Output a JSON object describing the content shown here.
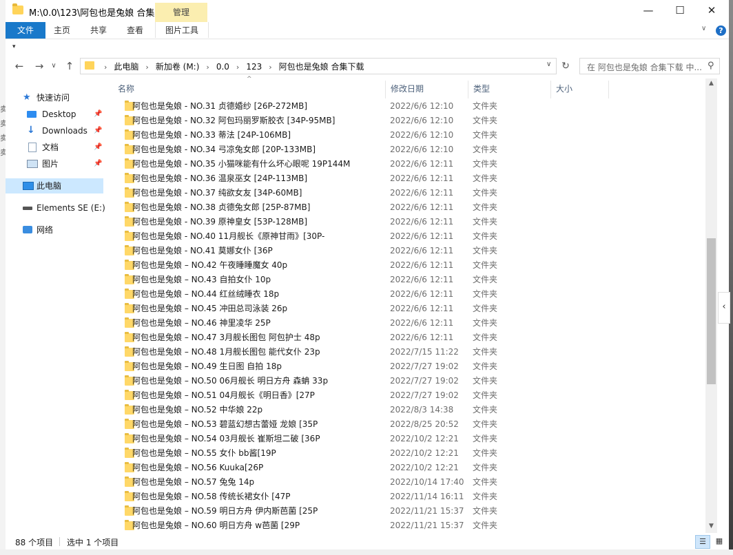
{
  "window": {
    "title": "M:\\0.0\\123\\阿包也是兔娘 合集...",
    "context_tab_header": "管理",
    "controls": {
      "minimize": "—",
      "maximize": "☐",
      "close": "✕"
    }
  },
  "ribbon": {
    "file_tab": "文件",
    "tabs": [
      "主页",
      "共享",
      "查看"
    ],
    "picture_tools_tab": "图片工具",
    "collapse": "∨",
    "help": "?"
  },
  "qat": {
    "arrow": "▾"
  },
  "nav": {
    "back": "←",
    "forward": "→",
    "recent": "∨",
    "up": "↑"
  },
  "address": {
    "crumbs": [
      "此电脑",
      "新加卷 (M:)",
      "0.0",
      "123",
      "阿包也是兔娘 合集下载"
    ],
    "separator": "›",
    "dropdown": "∨",
    "refresh": "↻"
  },
  "search": {
    "placeholder": "在 阿包也是兔娘 合集下载 中...",
    "icon": "⚲"
  },
  "outside_left_chars": [
    "卖",
    "卖",
    "卖",
    "卖"
  ],
  "navpane": {
    "quick_access": "快速访问",
    "items": [
      {
        "label": "Desktop",
        "icon": "desktop-icon"
      },
      {
        "label": "Downloads",
        "icon": "downloads-icon"
      },
      {
        "label": "文档",
        "icon": "documents-icon"
      },
      {
        "label": "图片",
        "icon": "pictures-icon"
      }
    ],
    "pin": "📌",
    "this_pc": "此电脑",
    "elements": "Elements SE (E:)",
    "network": "网络"
  },
  "columns": {
    "name": "名称",
    "date": "修改日期",
    "type": "类型",
    "size": "大小",
    "sort_arrow": "^"
  },
  "files": [
    {
      "name": "阿包也是兔娘 - NO.31 贞德婚纱 [26P-272MB]",
      "date": "2022/6/6 12:10",
      "type": "文件夹"
    },
    {
      "name": "阿包也是兔娘 - NO.32 阿包玛丽罗斯胶衣 [34P-95MB]",
      "date": "2022/6/6 12:10",
      "type": "文件夹"
    },
    {
      "name": "阿包也是兔娘 - NO.33 蒂法 [24P-106MB]",
      "date": "2022/6/6 12:10",
      "type": "文件夹"
    },
    {
      "name": "阿包也是兔娘 - NO.34 弓凉兔女郎 [20P-133MB]",
      "date": "2022/6/6 12:10",
      "type": "文件夹"
    },
    {
      "name": "阿包也是兔娘 - NO.35 小猫咪能有什么坏心眼呢 19P144M",
      "date": "2022/6/6 12:11",
      "type": "文件夹"
    },
    {
      "name": "阿包也是兔娘 - NO.36 温泉巫女 [24P-113MB]",
      "date": "2022/6/6 12:11",
      "type": "文件夹"
    },
    {
      "name": "阿包也是兔娘 - NO.37 纯欲女友 [34P-60MB]",
      "date": "2022/6/6 12:11",
      "type": "文件夹"
    },
    {
      "name": "阿包也是兔娘 - NO.38 贞德兔女郎 [25P-87MB]",
      "date": "2022/6/6 12:11",
      "type": "文件夹"
    },
    {
      "name": "阿包也是兔娘 - NO.39 原神皇女 [53P-128MB]",
      "date": "2022/6/6 12:11",
      "type": "文件夹"
    },
    {
      "name": "阿包也是兔娘 - NO.40 11月舰长《原神甘雨》[30P-",
      "date": "2022/6/6 12:11",
      "type": "文件夹"
    },
    {
      "name": "阿包也是兔娘 - NO.41 莫娜女仆 [36P",
      "date": "2022/6/6 12:11",
      "type": "文件夹"
    },
    {
      "name": "阿包也是兔娘 – NO.42 午夜睡睡魔女 40p",
      "date": "2022/6/6 12:11",
      "type": "文件夹"
    },
    {
      "name": "阿包也是兔娘 – NO.43 自拍女仆 10p",
      "date": "2022/6/6 12:11",
      "type": "文件夹"
    },
    {
      "name": "阿包也是兔娘 – NO.44 红丝绒睡衣 18p",
      "date": "2022/6/6 12:11",
      "type": "文件夹"
    },
    {
      "name": "阿包也是兔娘 – NO.45 冲田总司泳装 26p",
      "date": "2022/6/6 12:11",
      "type": "文件夹"
    },
    {
      "name": "阿包也是兔娘 – NO.46 神里凌华 25P",
      "date": "2022/6/6 12:11",
      "type": "文件夹"
    },
    {
      "name": "阿包也是兔娘 – NO.47 3月舰长图包 阿包护士 48p",
      "date": "2022/6/6 12:11",
      "type": "文件夹"
    },
    {
      "name": "阿包也是兔娘 – NO.48 1月舰长图包 能代女仆 23p",
      "date": "2022/7/15 11:22",
      "type": "文件夹"
    },
    {
      "name": "阿包也是兔娘 – NO.49 生日图 自拍 18p",
      "date": "2022/7/27 19:02",
      "type": "文件夹"
    },
    {
      "name": "阿包也是兔娘 – NO.50 06月舰长 明日方舟 森蚺 33p",
      "date": "2022/7/27 19:02",
      "type": "文件夹"
    },
    {
      "name": "阿包也是兔娘 – NO.51 04月舰长《明日香》[27P",
      "date": "2022/7/27 19:02",
      "type": "文件夹"
    },
    {
      "name": "阿包也是兔娘 – NO.52 中华娘 22p",
      "date": "2022/8/3 14:38",
      "type": "文件夹"
    },
    {
      "name": "阿包也是兔娘 – NO.53 碧蓝幻想古蕾娅 龙娘 [35P",
      "date": "2022/8/25 20:52",
      "type": "文件夹"
    },
    {
      "name": "阿包也是兔娘 – NO.54 03月舰长 崔斯坦二破 [36P",
      "date": "2022/10/2 12:21",
      "type": "文件夹"
    },
    {
      "name": "阿包也是兔娘 – NO.55 女仆 bb酱[19P",
      "date": "2022/10/2 12:21",
      "type": "文件夹"
    },
    {
      "name": "阿包也是兔娘 – NO.56 Kuuka[26P",
      "date": "2022/10/2 12:21",
      "type": "文件夹"
    },
    {
      "name": "阿包也是兔娘 – NO.57 兔兔 14p",
      "date": "2022/10/14 17:40",
      "type": "文件夹"
    },
    {
      "name": "阿包也是兔娘 – NO.58 传统长裙女仆 [47P",
      "date": "2022/11/14 16:11",
      "type": "文件夹"
    },
    {
      "name": "阿包也是兔娘 – NO.59 明日方舟 伊内斯芭菌 [25P",
      "date": "2022/11/21 15:37",
      "type": "文件夹"
    },
    {
      "name": "阿包也是兔娘 – NO.60 明日方舟 w芭菌 [29P",
      "date": "2022/11/21 15:37",
      "type": "文件夹"
    }
  ],
  "scrollbar": {
    "up": "▲",
    "down": "▼"
  },
  "side_handle": "‹",
  "status": {
    "count": "88 个项目",
    "selected": "选中 1 个项目",
    "view_details": "☰",
    "view_tiles": "▦"
  }
}
